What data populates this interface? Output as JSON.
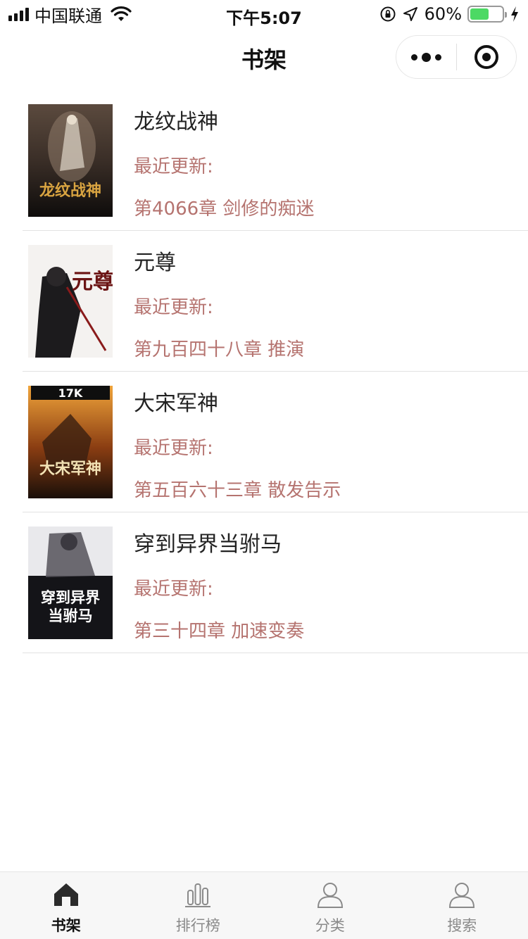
{
  "status_bar": {
    "carrier": "中国联通",
    "time": "下午5:07",
    "battery_percent": "60%",
    "battery_level": 0.6,
    "battery_color": "#4cd964"
  },
  "nav": {
    "title": "书架",
    "more_icon": "more-dots-icon",
    "close_icon": "target-circle-icon"
  },
  "books": [
    {
      "title": "龙纹战神",
      "updated_label": "最近更新:",
      "latest_chapter": "第4066章 剑修的痴迷",
      "cover_text": "龙纹战神"
    },
    {
      "title": "元尊",
      "updated_label": "最近更新:",
      "latest_chapter": "第九百四十八章 推演",
      "cover_text": "元尊"
    },
    {
      "title": "大宋军神",
      "updated_label": "最近更新:",
      "latest_chapter": "第五百六十三章 散发告示",
      "cover_text": "大宋军神",
      "cover_badge": "17K"
    },
    {
      "title": "穿到异界当驸马",
      "updated_label": "最近更新:",
      "latest_chapter": "第三十四章 加速变奏",
      "cover_text_line1": "穿到异界",
      "cover_text_line2": "当驸马"
    }
  ],
  "tabs": [
    {
      "label": "书架",
      "icon": "home-icon",
      "active": true
    },
    {
      "label": "排行榜",
      "icon": "bar-chart-icon",
      "active": false
    },
    {
      "label": "分类",
      "icon": "user-icon",
      "active": false
    },
    {
      "label": "搜索",
      "icon": "user-icon",
      "active": false
    }
  ],
  "colors": {
    "accent_text": "#b5736f",
    "tab_active": "#111111",
    "tab_inactive": "#8a8a8a"
  }
}
